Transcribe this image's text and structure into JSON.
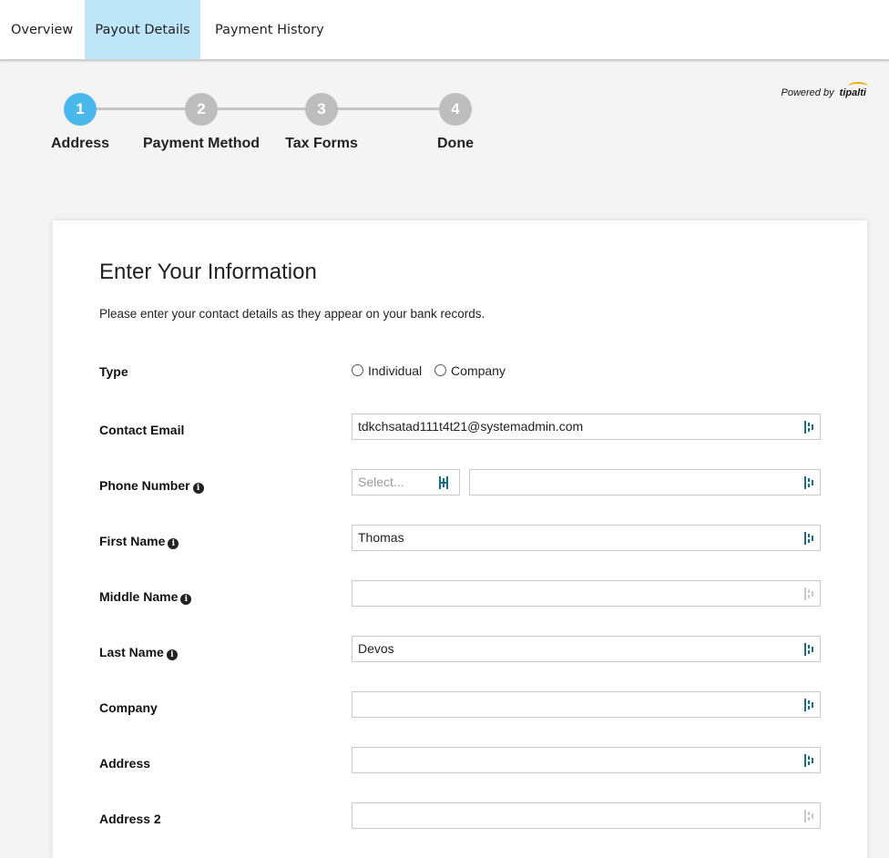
{
  "tabs": [
    {
      "label": "Overview"
    },
    {
      "label": "Payout Details"
    },
    {
      "label": "Payment History"
    }
  ],
  "powered": {
    "prefix": "Powered by",
    "brand": "tipalti"
  },
  "steps": [
    {
      "number": "1",
      "label": "Address"
    },
    {
      "number": "2",
      "label": "Payment Method"
    },
    {
      "number": "3",
      "label": "Tax Forms"
    },
    {
      "number": "4",
      "label": "Done"
    }
  ],
  "form": {
    "title": "Enter Your Information",
    "subtitle": "Please enter your contact details as they appear on your bank records.",
    "type_label": "Type",
    "type_options": [
      "Individual",
      "Company"
    ],
    "email_label": "Contact Email",
    "email_value": "tdkchsatad111t4t21@systemadmin.com",
    "phone_label": "Phone Number",
    "phone_code_placeholder": "Select...",
    "phone_value": "",
    "first_name_label": "First Name",
    "first_name_value": "Thomas",
    "middle_name_label": "Middle Name",
    "middle_name_value": "",
    "last_name_label": "Last Name",
    "last_name_value": "Devos",
    "company_label": "Company",
    "company_value": "",
    "address_label": "Address",
    "address_value": "",
    "address2_label": "Address 2",
    "address2_value": ""
  },
  "colors": {
    "active_tab": "#bde6f9",
    "active_step": "#4ab8ea",
    "inactive_step": "#bdbdbd",
    "field_icon": "#1a6d7f"
  }
}
